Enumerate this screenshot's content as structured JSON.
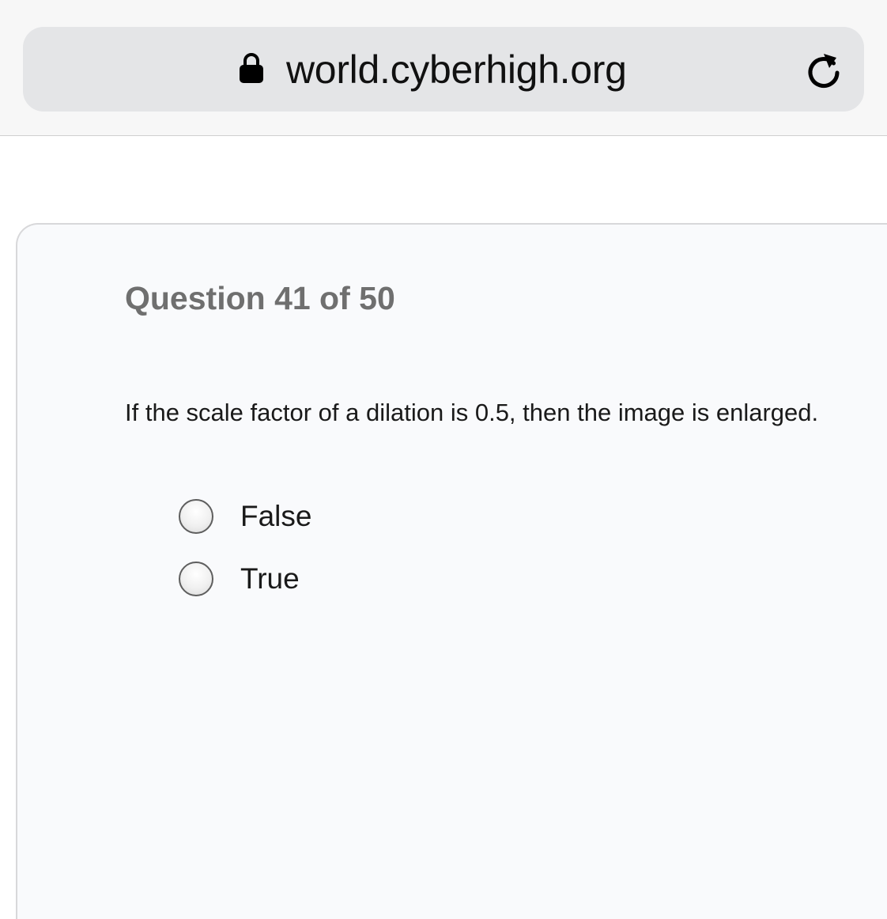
{
  "browser": {
    "url": "world.cyberhigh.org",
    "lock_icon": "lock-icon",
    "reload_icon": "reload-icon"
  },
  "quiz": {
    "header": "Question 41 of 50",
    "question": "If the scale factor of a dilation is 0.5, then the image is enlarged.",
    "options": [
      {
        "label": "False",
        "selected": false
      },
      {
        "label": "True",
        "selected": false
      }
    ]
  },
  "colors": {
    "header_text": "#6f6f6f",
    "card_background": "#f9fafc",
    "address_field": "#e4e5e7"
  }
}
